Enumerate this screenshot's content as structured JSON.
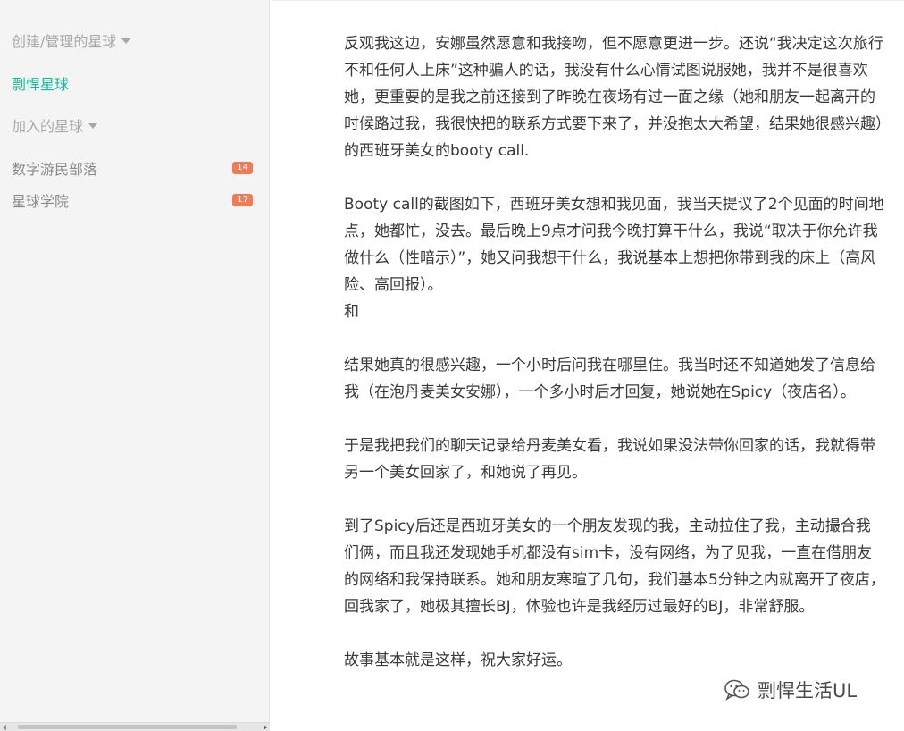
{
  "sidebar": {
    "managed_header": "创建/管理的星球",
    "managed_items": [
      {
        "label": "剽悍星球",
        "active": true
      }
    ],
    "joined_header": "加入的星球",
    "joined_items": [
      {
        "label": "数字游民部落",
        "badge": "14"
      },
      {
        "label": "星球学院",
        "badge": "17"
      }
    ]
  },
  "article": {
    "paragraphs": [
      "反观我这边，安娜虽然愿意和我接吻，但不愿意更进一步。还说“我决定这次旅行不和任何人上床”这种骗人的话，我没有什么心情试图说服她，我并不是很喜欢她，更重要的是我之前还接到了昨晚在夜场有过一面之缘（她和朋友一起离开的时候路过我，我很快把的联系方式要下来了，并没抱太大希望，结果她很感兴趣）的西班牙美女的booty call.",
      "Booty call的截图如下，西班牙美女想和我见面，我当天提议了2个见面的时间地点，她都忙，没去。最后晚上9点才问我今晚打算干什么，我说“取决于你允许我做什么（性暗示）”，她又问我想干什么，我说基本上想把你带到我的床上（高风险、高回报）。",
      "和",
      "结果她真的很感兴趣，一个小时后问我在哪里住。我当时还不知道她发了信息给我（在泡丹麦美女安娜），一个多小时后才回复，她说她在Spicy（夜店名）。",
      "于是我把我们的聊天记录给丹麦美女看，我说如果没法带你回家的话，我就得带另一个美女回家了，和她说了再见。",
      "到了Spicy后还是西班牙美女的一个朋友发现的我，主动拉住了我，主动撮合我们俩，而且我还发现她手机都没有sim卡，没有网络，为了见我，一直在借朋友的网络和我保持联系。她和朋友寒暄了几句，我们基本5分钟之内就离开了夜店，回我家了，她极其擅长BJ，体验也许是我经历过最好的BJ，非常舒服。",
      "故事基本就是这样，祝大家好运。"
    ]
  },
  "brand": {
    "icon": "wechat-icon",
    "name": "剽悍生活UL"
  },
  "colors": {
    "accent": "#16b998",
    "badge": "#ef7c57",
    "sidebar_bg": "#f4f4f4"
  }
}
